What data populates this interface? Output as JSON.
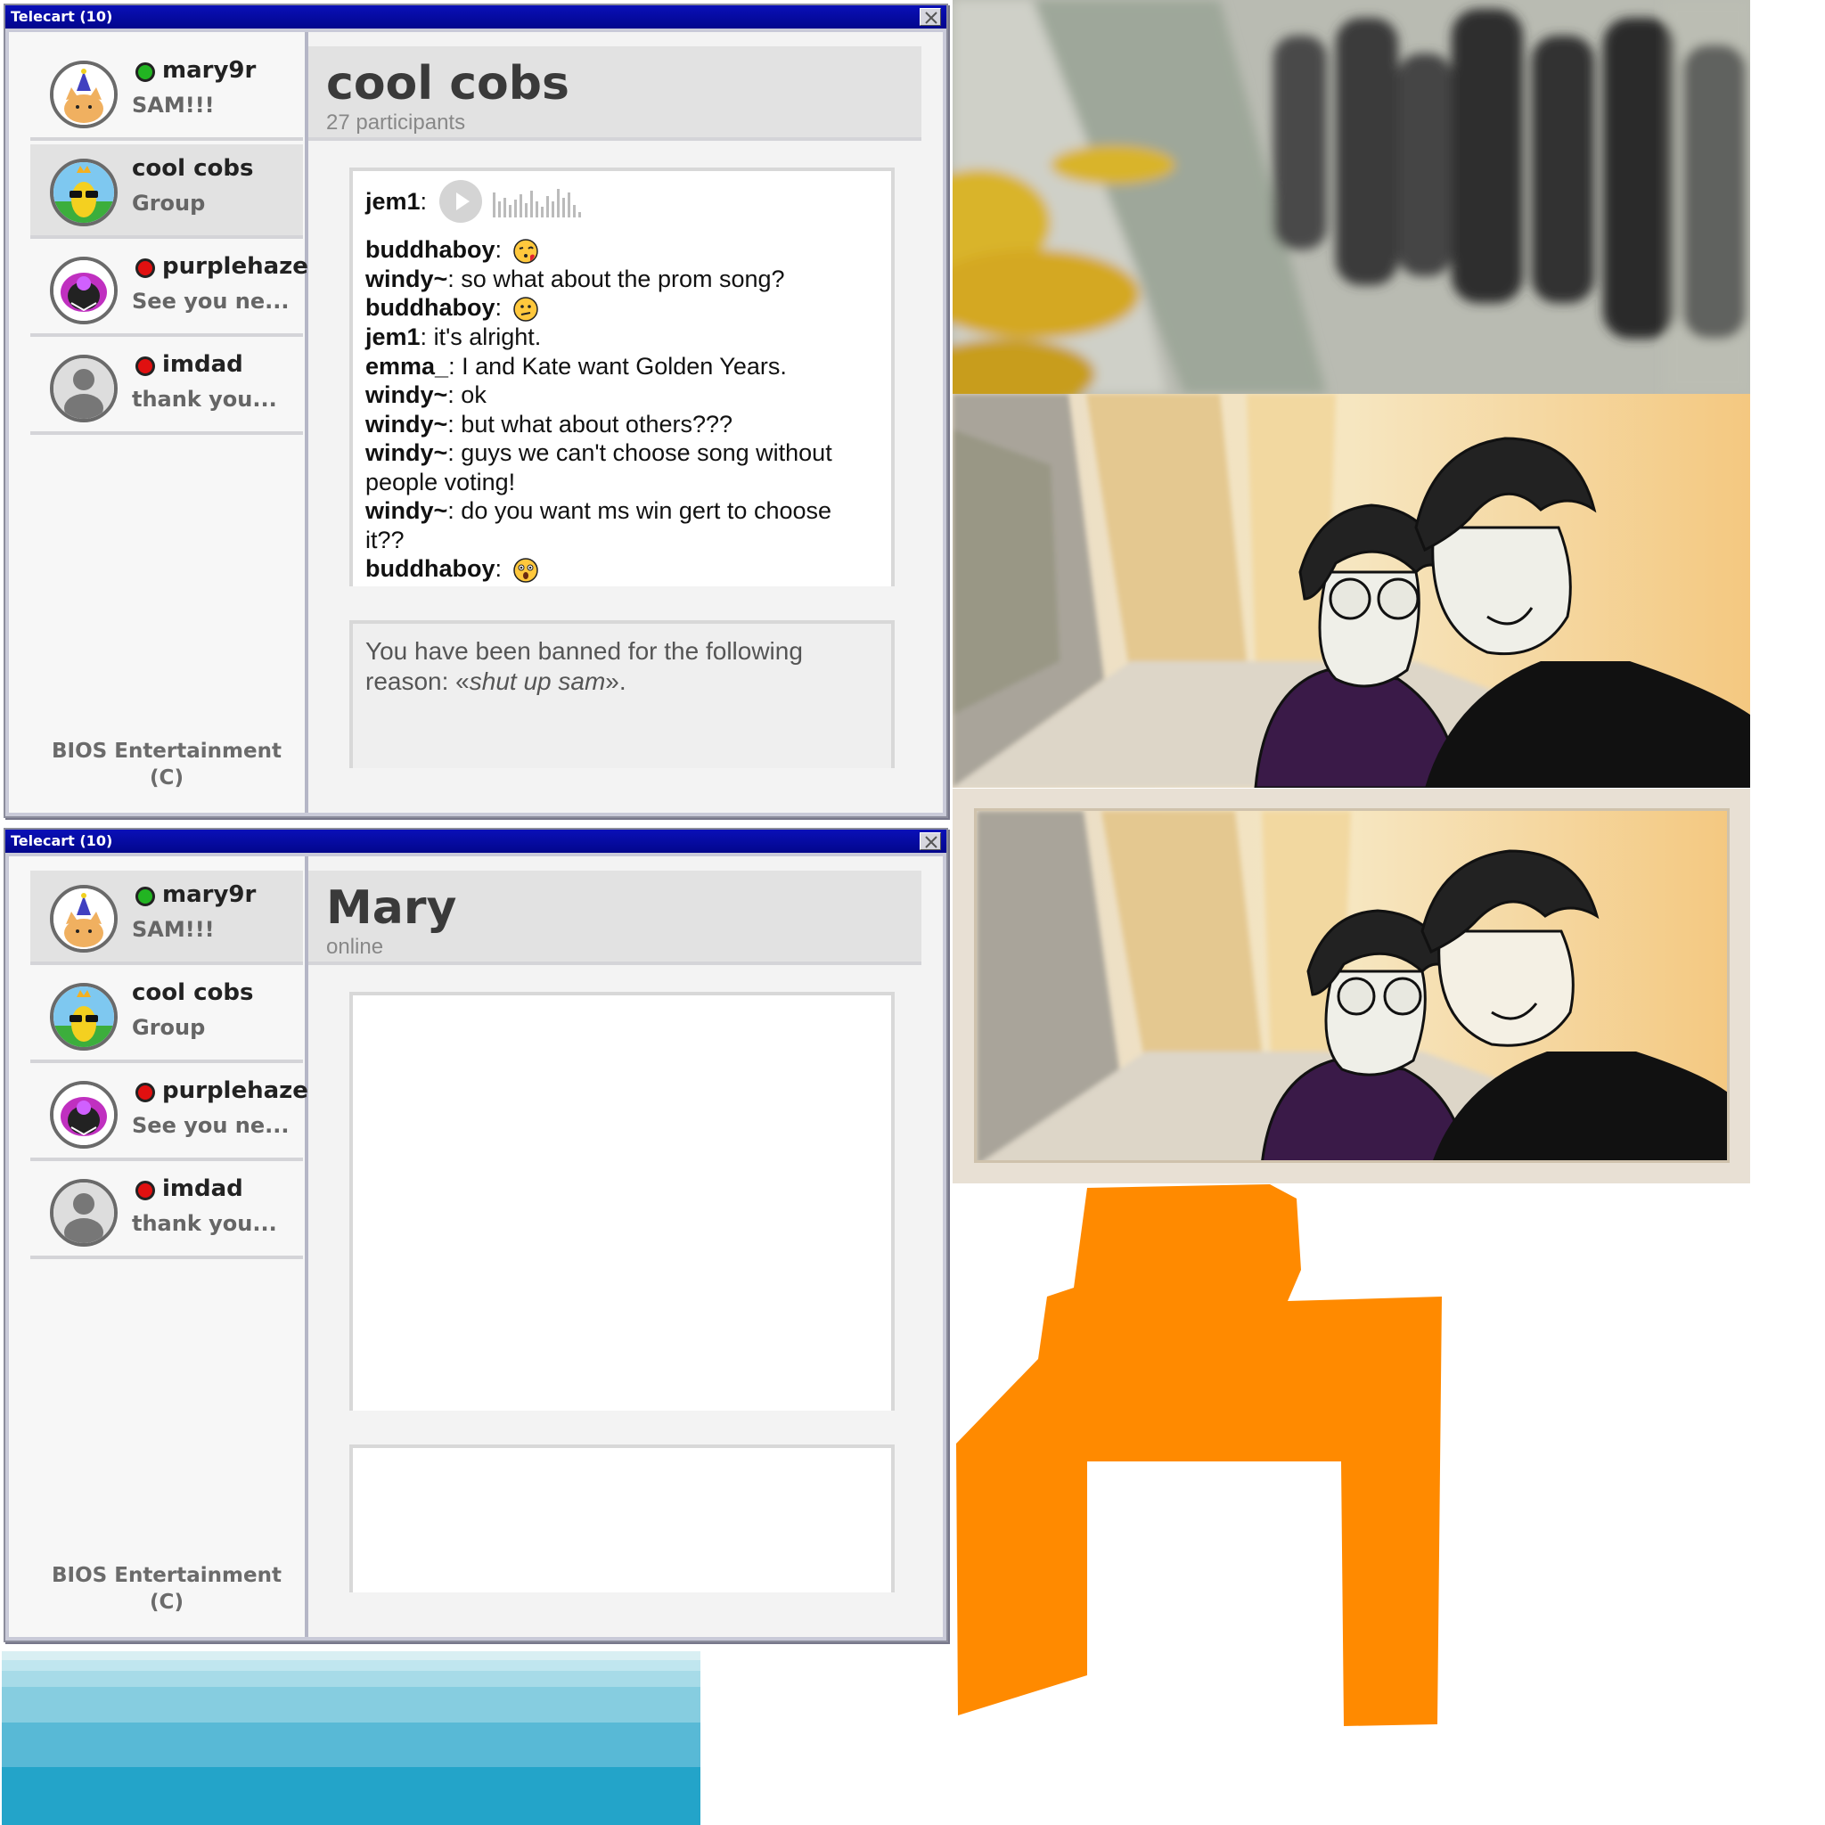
{
  "windows": [
    {
      "title": "Telecart (10)",
      "contacts": [
        {
          "name": "mary9r",
          "status": "online",
          "preview": "SAM!!!"
        },
        {
          "name": "cool cobs",
          "status": "",
          "preview": "Group"
        },
        {
          "name": "purplehaze",
          "status": "busy",
          "preview": "See you ne..."
        },
        {
          "name": "imdad",
          "status": "busy",
          "preview": "thank you..."
        }
      ],
      "footer_line1": "BIOS Entertainment",
      "footer_line2": "(C)",
      "chat": {
        "title": "cool cobs",
        "subtitle": "27 participants",
        "messages": [
          {
            "user": "jem1",
            "text": "",
            "attachment": "voice-message"
          },
          {
            "user": "buddhaboy",
            "text": "",
            "emoji": "kissing-face-icon"
          },
          {
            "user": "windy~",
            "text": "so what about the prom song?"
          },
          {
            "user": "buddhaboy",
            "text": "",
            "emoji": "confused-face-icon"
          },
          {
            "user": "jem1",
            "text": "it's alright."
          },
          {
            "user": "emma_",
            "text": "I and Kate want Golden Years."
          },
          {
            "user": "windy~",
            "text": "ok"
          },
          {
            "user": "windy~",
            "text": "but what about others???"
          },
          {
            "user": "windy~",
            "text": "guys we can't choose song without people voting!"
          },
          {
            "user": "windy~",
            "text": "do you want ms win gert to choose it??"
          },
          {
            "user": "buddhaboy",
            "text": "",
            "emoji": "astonished-face-icon"
          }
        ],
        "ban_notice_prefix": "You have been banned for the following reason: «",
        "ban_reason": "shut up sam",
        "ban_notice_suffix": "»."
      }
    },
    {
      "title": "Telecart (10)",
      "contacts": [
        {
          "name": "mary9r",
          "status": "online",
          "preview": "SAM!!!"
        },
        {
          "name": "cool cobs",
          "status": "",
          "preview": "Group"
        },
        {
          "name": "purplehaze",
          "status": "busy",
          "preview": "See you ne..."
        },
        {
          "name": "imdad",
          "status": "busy",
          "preview": "thank you..."
        }
      ],
      "footer_line1": "BIOS Entertainment",
      "footer_line2": "(C)",
      "chat": {
        "title": "Mary",
        "subtitle": "online"
      }
    }
  ],
  "colors": {
    "titlebar": "#02068c",
    "online": "#22b422",
    "busy": "#e01010",
    "orange_shape": "#ff8a00"
  }
}
